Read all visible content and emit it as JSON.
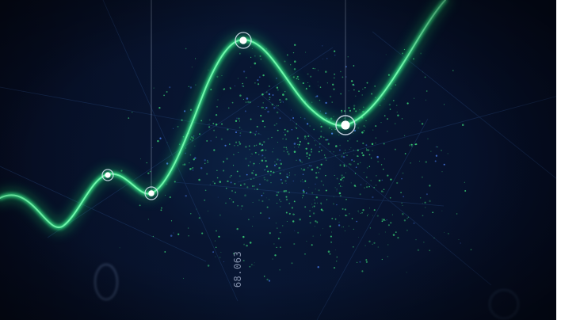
{
  "readout": {
    "value_text": "68.063"
  },
  "colors": {
    "curve": "#34f08a",
    "curve_glow": "#12c965",
    "background": "#040a1c",
    "particles": "#3ee07c",
    "node": "#ffffff"
  }
}
